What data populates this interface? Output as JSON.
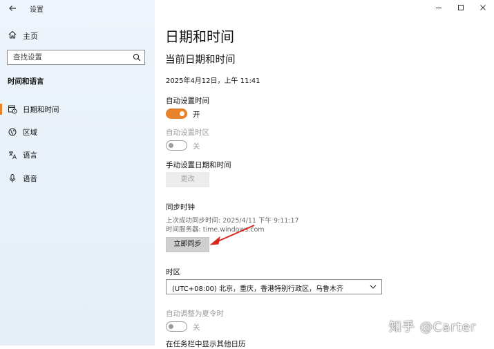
{
  "window": {
    "title": "设置",
    "controls": {
      "minimize": "—",
      "maximize": "☐",
      "close": "✕"
    }
  },
  "sidebar": {
    "home_label": "主页",
    "search_placeholder": "查找设置",
    "section_title": "时间和语言",
    "items": [
      {
        "label": "日期和时间",
        "icon": "calendar-clock-icon",
        "selected": true
      },
      {
        "label": "区域",
        "icon": "globe-icon",
        "selected": false
      },
      {
        "label": "语言",
        "icon": "language-icon",
        "selected": false
      },
      {
        "label": "语音",
        "icon": "microphone-icon",
        "selected": false
      }
    ]
  },
  "main": {
    "page_title": "日期和时间",
    "section_title": "当前日期和时间",
    "current_datetime": "2025年4月12日，上午 11:41",
    "auto_time": {
      "label": "自动设置时间",
      "state_text": "开",
      "on": true
    },
    "auto_timezone": {
      "label": "自动设置时区",
      "state_text": "关",
      "on": false,
      "disabled": true
    },
    "manual": {
      "label": "手动设置日期和时间",
      "button": "更改"
    },
    "sync": {
      "label": "同步时钟",
      "last_sync": "上次成功同步时间: 2025/4/11 下午 9:11:17",
      "server": "时间服务器: time.windows.com",
      "button": "立即同步"
    },
    "timezone": {
      "label": "时区",
      "value": "(UTC+08:00) 北京，重庆，香港特别行政区，乌鲁木齐"
    },
    "dst": {
      "label": "自动调整为夏令时",
      "state_text": "关",
      "on": false,
      "disabled": true
    },
    "cutoff_text": "在任务栏中显示其他日历"
  },
  "watermark": "知乎 @Carter",
  "colors": {
    "accent": "#e8822b",
    "annotation_arrow": "#d9261c"
  }
}
